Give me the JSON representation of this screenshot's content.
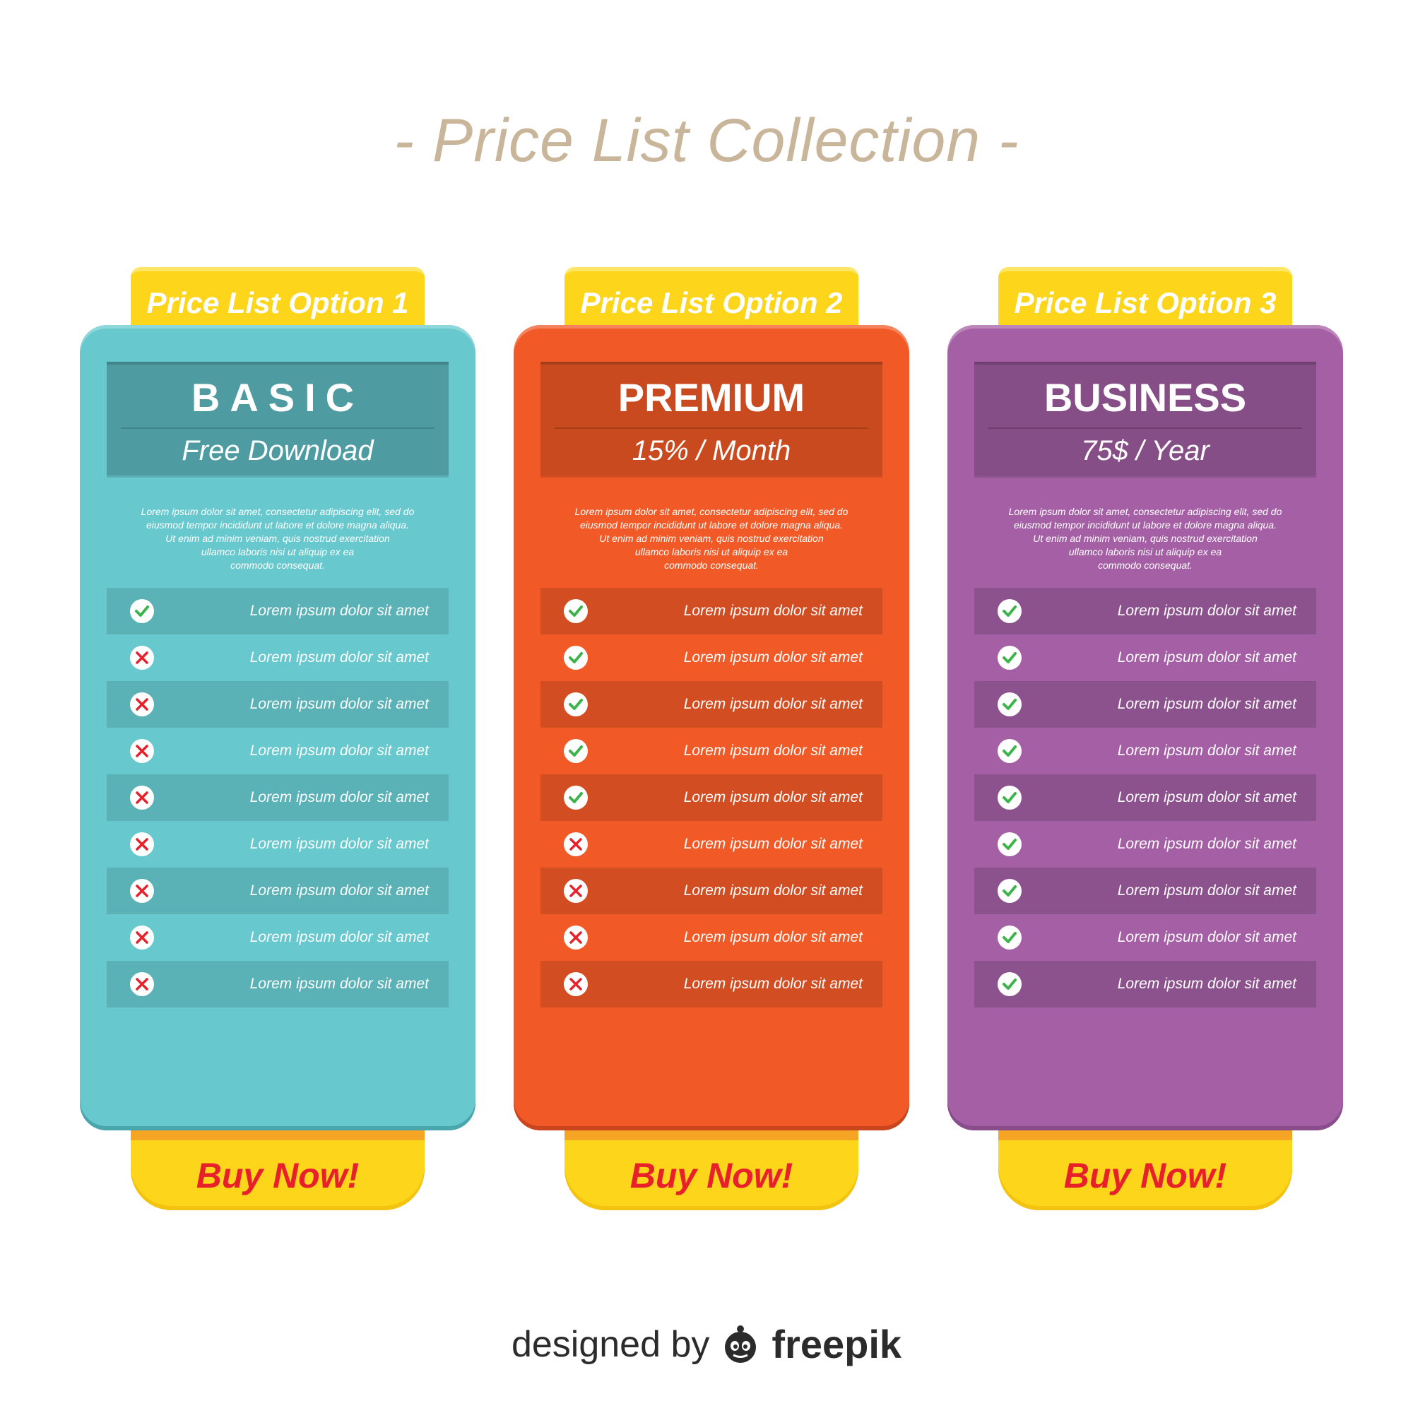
{
  "title": "- Price List Collection -",
  "colors": {
    "title": "#c9b59a",
    "tab_yellow": "#fdd51a",
    "buy_text": "#e8202a",
    "check": "#3cb44b",
    "cross": "#e8202a"
  },
  "plans": [
    {
      "option_label": "Price List Option 1",
      "name": "BASIC",
      "price": "Free Download",
      "description": "Lorem ipsum dolor sit amet, consectetur adipiscing elit, sed do\neiusmod tempor incididunt ut labore et dolore magna aliqua.\nUt enim ad minim veniam, quis nostrud exercitation\nullamco laboris nisi ut aliquip ex ea\ncommodo consequat.",
      "buy_label": "Buy Now!",
      "colors": {
        "card": "#67c8ce",
        "header": "#4e9ca1",
        "row": "#5ab1b6",
        "bottom": "#4aa6ad",
        "divider": "#3f8489"
      },
      "features": [
        {
          "text": "Lorem ipsum dolor sit amet",
          "included": true,
          "icon": "check-icon"
        },
        {
          "text": "Lorem ipsum dolor sit amet",
          "included": false,
          "icon": "cross-icon"
        },
        {
          "text": "Lorem ipsum dolor sit amet",
          "included": false,
          "icon": "cross-icon"
        },
        {
          "text": "Lorem ipsum dolor sit amet",
          "included": false,
          "icon": "cross-icon"
        },
        {
          "text": "Lorem ipsum dolor sit amet",
          "included": false,
          "icon": "cross-icon"
        },
        {
          "text": "Lorem ipsum dolor sit amet",
          "included": false,
          "icon": "cross-icon"
        },
        {
          "text": "Lorem ipsum dolor sit amet",
          "included": false,
          "icon": "cross-icon"
        },
        {
          "text": "Lorem ipsum dolor sit amet",
          "included": false,
          "icon": "cross-icon"
        },
        {
          "text": "Lorem ipsum dolor sit amet",
          "included": false,
          "icon": "cross-icon"
        }
      ]
    },
    {
      "option_label": "Price List Option 2",
      "name": "PREMIUM",
      "price": "15% / Month",
      "description": "Lorem ipsum dolor sit amet, consectetur adipiscing elit, sed do\neiusmod tempor incididunt ut labore et dolore magna aliqua.\nUt enim ad minim veniam, quis nostrud exercitation\nullamco laboris nisi ut aliquip ex ea\ncommodo consequat.",
      "buy_label": "Buy Now!",
      "colors": {
        "card": "#f15a27",
        "header": "#c94a1f",
        "row": "#d24d21",
        "bottom": "#c8451d",
        "divider": "#a83d19"
      },
      "features": [
        {
          "text": "Lorem ipsum dolor sit amet",
          "included": true,
          "icon": "check-icon"
        },
        {
          "text": "Lorem ipsum dolor sit amet",
          "included": true,
          "icon": "check-icon"
        },
        {
          "text": "Lorem ipsum dolor sit amet",
          "included": true,
          "icon": "check-icon"
        },
        {
          "text": "Lorem ipsum dolor sit amet",
          "included": true,
          "icon": "check-icon"
        },
        {
          "text": "Lorem ipsum dolor sit amet",
          "included": true,
          "icon": "check-icon"
        },
        {
          "text": "Lorem ipsum dolor sit amet",
          "included": false,
          "icon": "cross-icon"
        },
        {
          "text": "Lorem ipsum dolor sit amet",
          "included": false,
          "icon": "cross-icon"
        },
        {
          "text": "Lorem ipsum dolor sit amet",
          "included": false,
          "icon": "cross-icon"
        },
        {
          "text": "Lorem ipsum dolor sit amet",
          "included": false,
          "icon": "cross-icon"
        }
      ]
    },
    {
      "option_label": "Price List Option 3",
      "name": "BUSINESS",
      "price": "75$ / Year",
      "description": "Lorem ipsum dolor sit amet, consectetur adipiscing elit, sed do\neiusmod tempor incididunt ut labore et dolore magna aliqua.\nUt enim ad minim veniam, quis nostrud exercitation\nullamco laboris nisi ut aliquip ex ea\ncommodo consequat.",
      "buy_label": "Buy Now!",
      "colors": {
        "card": "#a45fa5",
        "header": "#864e86",
        "row": "#8c528d",
        "bottom": "#8a4d8b",
        "divider": "#6f3f70"
      },
      "features": [
        {
          "text": "Lorem ipsum dolor sit amet",
          "included": true,
          "icon": "check-icon"
        },
        {
          "text": "Lorem ipsum dolor sit amet",
          "included": true,
          "icon": "check-icon"
        },
        {
          "text": "Lorem ipsum dolor sit amet",
          "included": true,
          "icon": "check-icon"
        },
        {
          "text": "Lorem ipsum dolor sit amet",
          "included": true,
          "icon": "check-icon"
        },
        {
          "text": "Lorem ipsum dolor sit amet",
          "included": true,
          "icon": "check-icon"
        },
        {
          "text": "Lorem ipsum dolor sit amet",
          "included": true,
          "icon": "check-icon"
        },
        {
          "text": "Lorem ipsum dolor sit amet",
          "included": true,
          "icon": "check-icon"
        },
        {
          "text": "Lorem ipsum dolor sit amet",
          "included": true,
          "icon": "check-icon"
        },
        {
          "text": "Lorem ipsum dolor sit amet",
          "included": true,
          "icon": "check-icon"
        }
      ]
    }
  ],
  "credit": {
    "prefix": "designed by",
    "brand": "freepik",
    "icon": "freepik-logo-icon"
  }
}
